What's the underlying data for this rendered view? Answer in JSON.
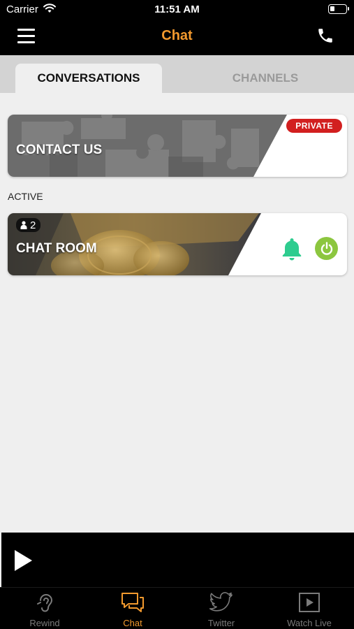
{
  "status_bar": {
    "carrier": "Carrier",
    "time": "11:51 AM"
  },
  "header": {
    "title": "Chat",
    "menu_icon": "hamburger-icon",
    "call_icon": "phone-icon"
  },
  "tabs": [
    {
      "label": "CONVERSATIONS",
      "active": true
    },
    {
      "label": "CHANNELS",
      "active": false
    }
  ],
  "contact_card": {
    "title": "CONTACT US",
    "badge": "PRIVATE"
  },
  "active_section": {
    "label": "ACTIVE"
  },
  "chat_room_card": {
    "title": "CHAT ROOM",
    "member_count": "2",
    "bell_icon": "bell-icon",
    "power_icon": "power-icon"
  },
  "player": {
    "play_icon": "play-icon"
  },
  "bottom_nav": [
    {
      "label": "Rewind",
      "icon": "ear-icon",
      "active": false
    },
    {
      "label": "Chat",
      "icon": "chat-bubbles-icon",
      "active": true
    },
    {
      "label": "Twitter",
      "icon": "twitter-bird-icon",
      "active": false
    },
    {
      "label": "Watch Live",
      "icon": "video-play-icon",
      "active": false
    }
  ],
  "colors": {
    "accent": "#f39a2e",
    "private_badge": "#d21f1f",
    "bell": "#2ecc8f",
    "power": "#8cc63f"
  }
}
